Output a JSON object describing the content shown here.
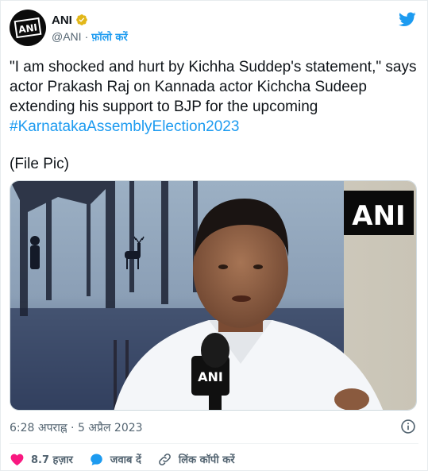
{
  "account": {
    "name": "ANI",
    "handle": "@ANI",
    "separator": "·",
    "follow_label": "फ़ॉलो करें",
    "avatar_text": "ANI"
  },
  "tweet": {
    "text": "\"I am shocked and hurt by Kichha Suddep's statement,\" says actor Prakash Raj on Kannada actor Kichcha Sudeep extending his support to BJP for the upcoming",
    "hashtag": "#KarnatakaAssemblyElection2023",
    "note": "(File Pic)"
  },
  "media": {
    "watermark": "ANI",
    "mic_label": "ANI"
  },
  "meta": {
    "timestamp": "6:28 अपराह्न · 5 अप्रैल 2023"
  },
  "actions": {
    "likes": "8.7 हज़ार",
    "reply": "जवाब दें",
    "copy_link": "लिंक कॉपी करें"
  },
  "colors": {
    "accent": "#1d9bf0",
    "like": "#f91880",
    "verified": "#e2b719"
  }
}
